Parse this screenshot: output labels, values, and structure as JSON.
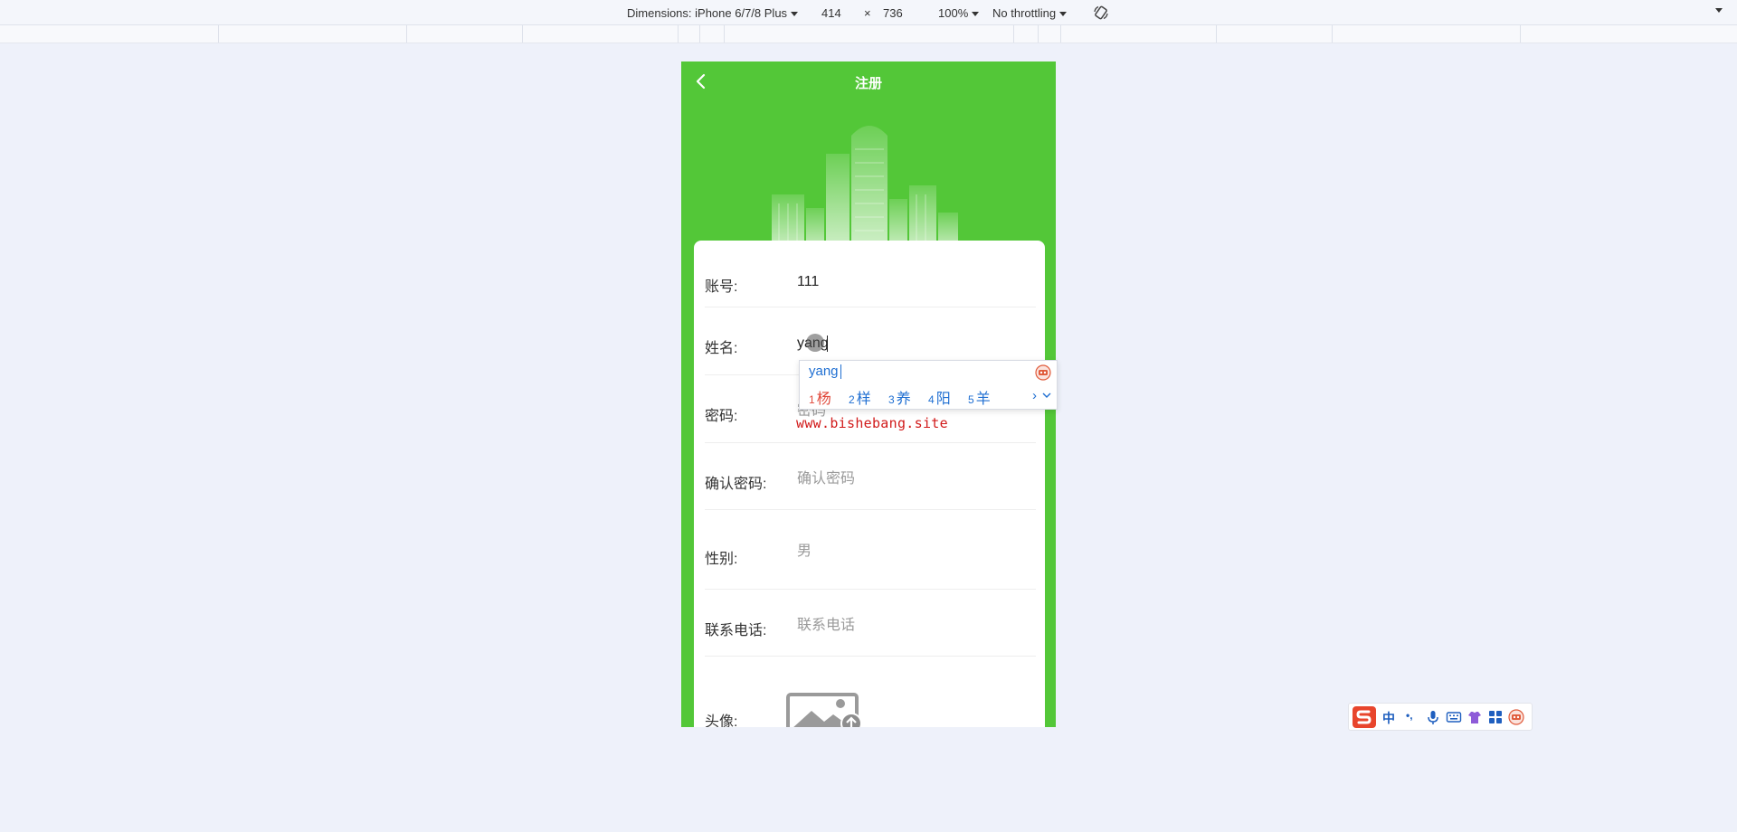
{
  "devtools": {
    "dimensions_label": "Dimensions: iPhone 6/7/8 Plus",
    "width": "414",
    "times": "×",
    "height": "736",
    "zoom": "100%",
    "throttling": "No throttling"
  },
  "app": {
    "title": "注册",
    "fields": [
      {
        "label": "账号:",
        "value": "111",
        "placeholder": ""
      },
      {
        "label": "姓名:",
        "value": "yang",
        "placeholder": ""
      },
      {
        "label": "密码:",
        "value": "",
        "placeholder": "密码"
      },
      {
        "label": "确认密码:",
        "value": "",
        "placeholder": "确认密码"
      },
      {
        "label": "性别:",
        "value": "男",
        "placeholder": ""
      },
      {
        "label": "联系电话:",
        "value": "",
        "placeholder": "联系电话"
      },
      {
        "label": "头像:",
        "value": "",
        "placeholder": ""
      }
    ],
    "accent_color": "#53c738"
  },
  "watermark": "www.bishebang.site",
  "ime": {
    "composition": "yang",
    "candidates": [
      {
        "num": "1",
        "char": "杨"
      },
      {
        "num": "2",
        "char": "样"
      },
      {
        "num": "3",
        "char": "养"
      },
      {
        "num": "4",
        "char": "阳"
      },
      {
        "num": "5",
        "char": "羊"
      }
    ],
    "next_glyph": "›",
    "status_bar": {
      "mode_label": "中",
      "punct_label": "•,",
      "icons": [
        "sogou-logo-icon",
        "mode-zh",
        "punctuation-icon",
        "microphone-icon",
        "keyboard-icon",
        "skin-icon",
        "toolbox-icon",
        "avatar-icon"
      ]
    }
  }
}
